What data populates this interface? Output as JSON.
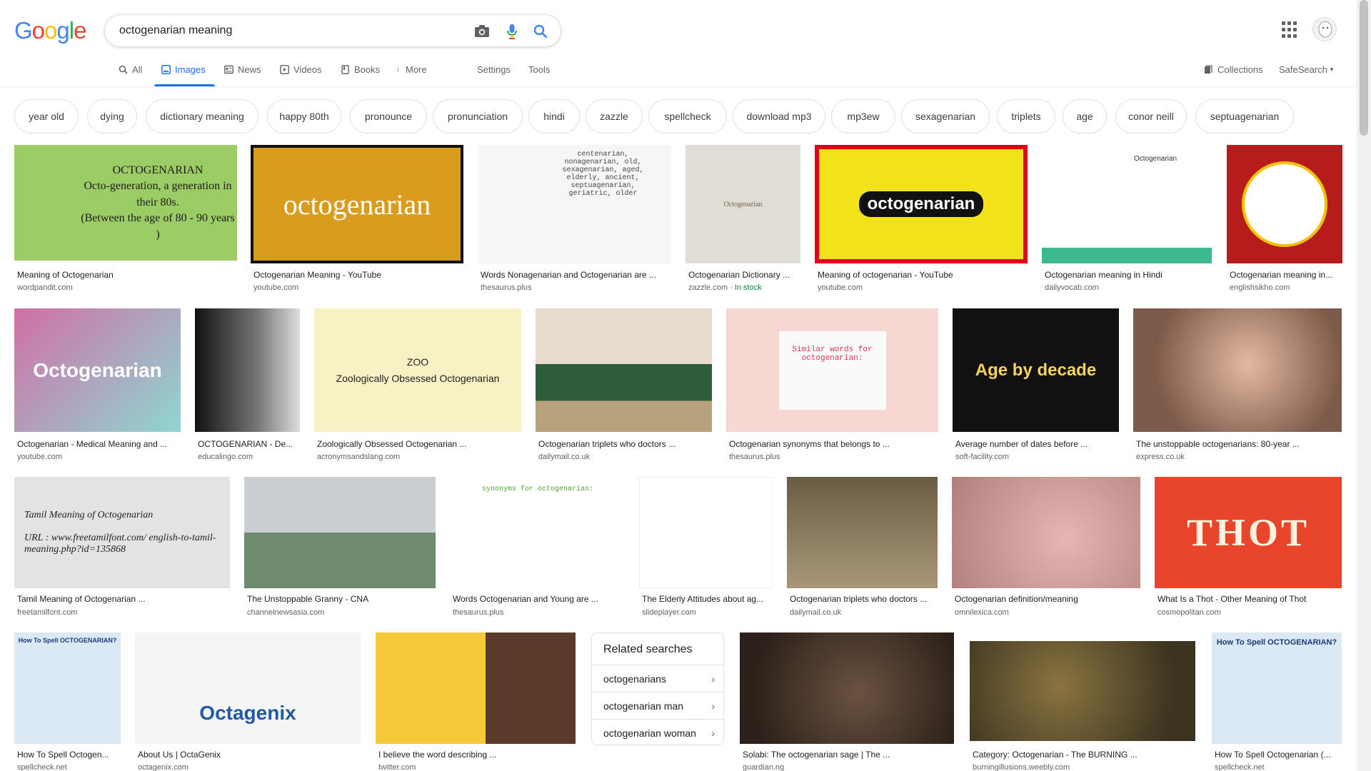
{
  "logo": [
    "G",
    "o",
    "o",
    "g",
    "l",
    "e"
  ],
  "logo_colors": [
    "#4285f4",
    "#ea4335",
    "#fbbc05",
    "#4285f4",
    "#34a853",
    "#ea4335"
  ],
  "search": {
    "query": "octogenarian meaning"
  },
  "tabs": {
    "all": "All",
    "images": "Images",
    "news": "News",
    "videos": "Videos",
    "books": "Books",
    "more": "More",
    "settings": "Settings",
    "tools": "Tools",
    "collections": "Collections",
    "safesearch": "SafeSearch"
  },
  "chips": [
    "year old",
    "dying",
    "dictionary meaning",
    "happy 80th",
    "pronounce",
    "pronunciation",
    "hindi",
    "zazzle",
    "spellcheck",
    "download mp3",
    "mp3ew",
    "sexagenarian",
    "triplets",
    "age",
    "conor neill",
    "septuagenarian"
  ],
  "row1": [
    {
      "caption": "Meaning of Octogenarian",
      "source": "wordpandit.com",
      "thumb_text": "OCTOGENARIAN\nOcto-generation, a generation in their 80s.\n(Between the age of 80 - 90 years )",
      "bg": "#9ccc65"
    },
    {
      "caption": "Octogenarian Meaning - YouTube",
      "source": "youtube.com",
      "thumb_text": "octogenarian",
      "bg": "#d99c1c"
    },
    {
      "caption": "Words Nonagenarian and Octogenarian are ...",
      "source": "thesaurus.plus",
      "thumb_text": "centenarian, nonagenarian, old, sexagenarian, aged, elderly, ancient, septuagenarian, geriatric, older",
      "bg": "#f4f6f8"
    },
    {
      "caption": "Octogenarian Dictionary ...",
      "source": "zazzle.com",
      "source_extra": "In stock",
      "thumb_text": "Octogenarian",
      "bg": "#e0ddd6"
    },
    {
      "caption": "Meaning of octogenarian - YouTube",
      "source": "youtube.com",
      "thumb_text": "octogenarian",
      "bg": "#f2e21a"
    },
    {
      "caption": "Octogenarian meaning in Hindi",
      "source": "dailyvocab.com",
      "thumb_text": "Octogenarian",
      "bg": "#ffffff"
    },
    {
      "caption": "Octogenarian meaning in...",
      "source": "englishsikho.com",
      "thumb_text": "",
      "bg": "#b71c1c"
    }
  ],
  "row2": [
    {
      "caption": "Octogenarian - Medical Meaning and ...",
      "source": "youtube.com",
      "thumb_text": "Octogenarian",
      "bg": "#c77ba8"
    },
    {
      "caption": "OCTOGENARIAN - De...",
      "source": "educalingo.com",
      "thumb_text": "",
      "bg": "#3a3a3a"
    },
    {
      "caption": "Zoologically Obsessed Octogenarian ...",
      "source": "acronymsandslang.com",
      "thumb_text": "ZOO\nZoologically Obsessed Octogenarian",
      "bg": "#f7f1c4"
    },
    {
      "caption": "Octogenarian triplets who doctors ...",
      "source": "dailymail.co.uk",
      "thumb_text": "",
      "bg": "#8b7d6b"
    },
    {
      "caption": "Octogenarian synonyms that belongs to ...",
      "source": "thesaurus.plus",
      "thumb_text": "Similar words for octogenarian:",
      "bg": "#f6d7d2"
    },
    {
      "caption": "Average number of dates before ...",
      "source": "soft-facility.com",
      "thumb_text": "Age by decade",
      "bg": "#111111"
    },
    {
      "caption": "The unstoppable octogenarians: 80-year ...",
      "source": "express.co.uk",
      "thumb_text": "",
      "bg": "#c9a898"
    }
  ],
  "row3": [
    {
      "caption": "Tamil Meaning of Octogenarian ...",
      "source": "freetamilfont.com",
      "thumb_text": "Tamil Meaning of Octogenarian\n\nURL : www.freetamilfont.com/ english-to-tamil-meaning.php?id=135868",
      "bg": "#e3e3e3"
    },
    {
      "caption": "The Unstoppable Granny - CNA",
      "source": "channelnewsasia.com",
      "thumb_text": "",
      "bg": "#a7b3b8"
    },
    {
      "caption": "Words Octogenarian and Young are ...",
      "source": "thesaurus.plus",
      "thumb_text": "synonyms for octogenarian:",
      "bg": "#ffffff"
    },
    {
      "caption": "The Elderly Attitudes about ag...",
      "source": "slideplayer.com",
      "thumb_text": "",
      "bg": "#ffffff"
    },
    {
      "caption": "Octogenarian triplets who doctors ...",
      "source": "dailymail.co.uk",
      "thumb_text": "",
      "bg": "#8a7a5c"
    },
    {
      "caption": "Octogenarian definition/meaning",
      "source": "omnilexica.com",
      "thumb_text": "",
      "bg": "#d8a9a5"
    },
    {
      "caption": "What Is a Thot - Other Meaning of Thot",
      "source": "cosmopolitan.com",
      "thumb_text": "THOT",
      "bg": "#e8452a"
    }
  ],
  "row4": [
    {
      "caption": "How To Spell Octogen...",
      "source": "spellcheck.net",
      "thumb_text": "How To Spell OCTOGENARIAN?",
      "bg": "#dbe9f5"
    },
    {
      "caption": "About Us | OctaGenix",
      "source": "octagenix.com",
      "thumb_text": "Octagenix",
      "bg": "#f5f5f5"
    },
    {
      "caption": "I believe the word describing ...",
      "source": "twitter.com",
      "thumb_text": "",
      "bg": "#7fb0d8"
    },
    {
      "caption": "Solabi: The octogenarian sage | The ...",
      "source": "guardian.ng",
      "thumb_text": "",
      "bg": "#4a3a2c"
    },
    {
      "caption": "Category: Octogenarian - The BURNING ...",
      "source": "burningillusions.weebly.com",
      "thumb_text": "",
      "bg": "#6b5a32"
    },
    {
      "caption": "How To Spell Octogenarian (...",
      "source": "spellcheck.net",
      "thumb_text": "How To Spell OCTOGENARIAN?",
      "bg": "#dbe9f5"
    }
  ],
  "related": {
    "title": "Related searches",
    "items": [
      "octogenarians",
      "octogenarian man",
      "octogenarian woman"
    ]
  },
  "icons": [
    "camera-icon",
    "mic-icon",
    "search-icon",
    "apps-icon",
    "bookmark-icon"
  ]
}
